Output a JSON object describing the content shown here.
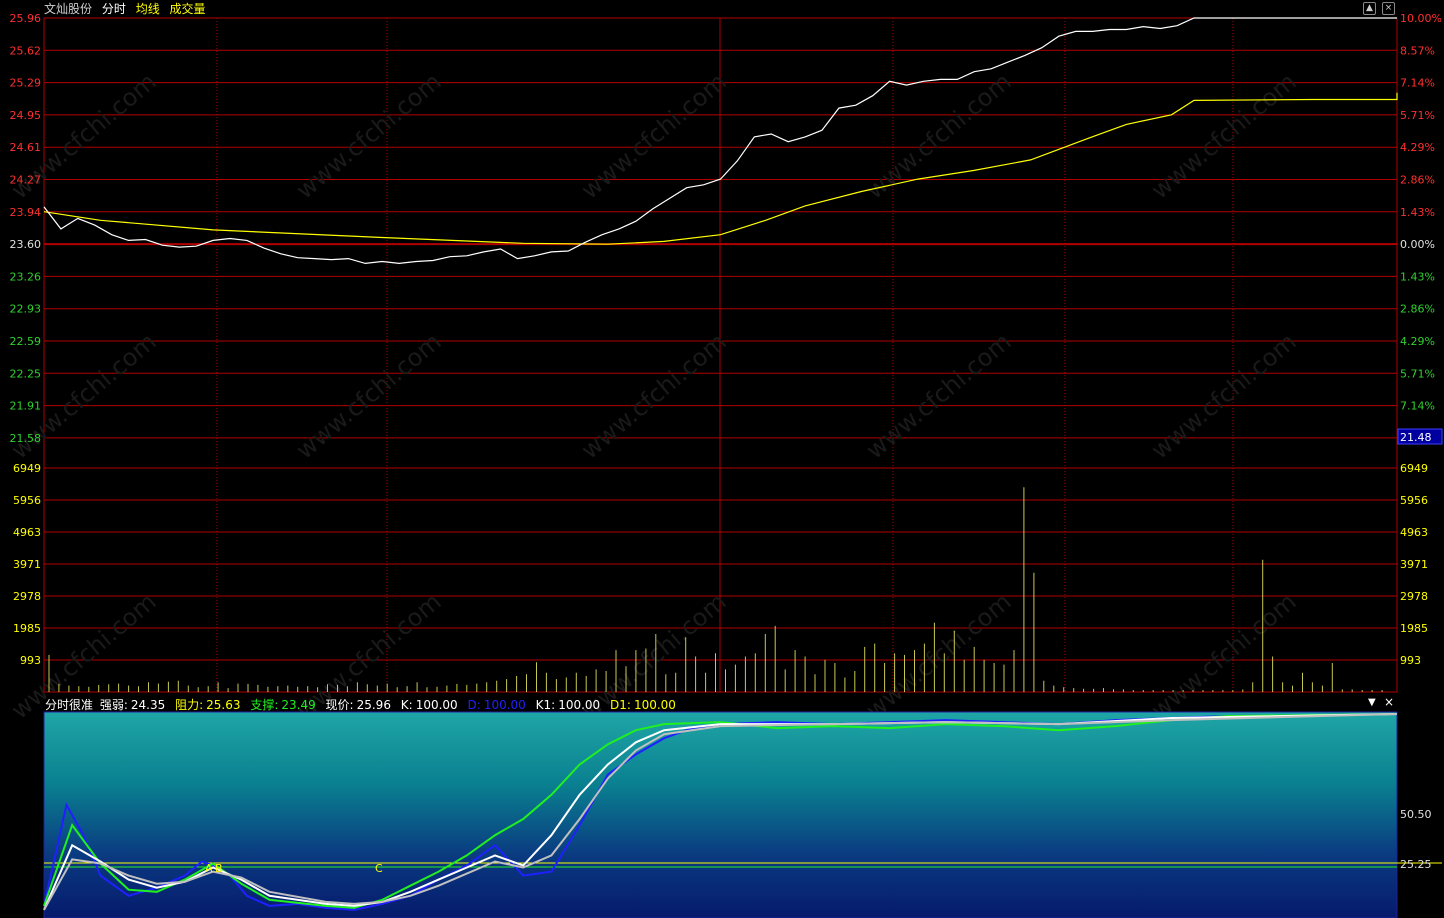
{
  "header": {
    "stock_name": "文灿股份",
    "tab_minute": "分时",
    "tab_avg": "均线",
    "tab_volume": "成交量"
  },
  "indicator_header": {
    "name": "分时很准",
    "strength_label": "强弱:",
    "strength_value": "24.35",
    "resistance_label": "阻力:",
    "resistance_value": "25.63",
    "support_label": "支撑:",
    "support_value": "23.49",
    "price_label": "现价:",
    "price_value": "25.96",
    "k_label": "K:",
    "k_value": "100.00",
    "d_label": "D:",
    "d_value": "100.00",
    "k1_label": "K1:",
    "k1_value": "100.00",
    "d1_label": "D1:",
    "d1_value": "100.00"
  },
  "colors": {
    "grid": "#b00000",
    "price_line": "#ffffff",
    "avg_line": "#ffff00",
    "volume_bar": "#c8c850",
    "up_axis": "#ff3030",
    "down_axis": "#30d030",
    "k_line": "#2020ff",
    "d_line": "#20f020",
    "k1_line": "#ffffff",
    "d1_line": "#c0c0c0"
  },
  "flag_labels": {
    "a": "A",
    "b": "B",
    "c": "C"
  },
  "chart_data": [
    {
      "type": "line",
      "title": "分时",
      "prev_close": 23.6,
      "ylim": [
        21.58,
        25.96
      ],
      "left_ticks": [
        "25.96",
        "25.62",
        "25.29",
        "24.95",
        "24.61",
        "24.27",
        "23.94",
        "23.60",
        "23.26",
        "22.93",
        "22.59",
        "22.25",
        "21.91",
        "21.58"
      ],
      "right_ticks": [
        "10.00%",
        "8.57%",
        "7.14%",
        "5.71%",
        "4.29%",
        "2.86%",
        "1.43%",
        "0.00%",
        "1.43%",
        "2.86%",
        "4.29%",
        "5.71%",
        "7.14%",
        "8.57%"
      ],
      "current_marker": "21.48",
      "x_minutes": 240,
      "series": [
        {
          "name": "分时",
          "key": "price",
          "points": [
            [
              0,
              23.99
            ],
            [
              3,
              23.76
            ],
            [
              6,
              23.87
            ],
            [
              9,
              23.8
            ],
            [
              12,
              23.7
            ],
            [
              15,
              23.64
            ],
            [
              18,
              23.65
            ],
            [
              21,
              23.59
            ],
            [
              24,
              23.57
            ],
            [
              27,
              23.58
            ],
            [
              30,
              23.64
            ],
            [
              33,
              23.66
            ],
            [
              36,
              23.64
            ],
            [
              39,
              23.56
            ],
            [
              42,
              23.5
            ],
            [
              45,
              23.46
            ],
            [
              48,
              23.45
            ],
            [
              51,
              23.44
            ],
            [
              54,
              23.45
            ],
            [
              57,
              23.4
            ],
            [
              60,
              23.42
            ],
            [
              63,
              23.4
            ],
            [
              66,
              23.42
            ],
            [
              69,
              23.43
            ],
            [
              72,
              23.47
            ],
            [
              75,
              23.48
            ],
            [
              78,
              23.52
            ],
            [
              81,
              23.55
            ],
            [
              84,
              23.45
            ],
            [
              87,
              23.48
            ],
            [
              90,
              23.52
            ],
            [
              93,
              23.53
            ],
            [
              96,
              23.62
            ],
            [
              99,
              23.7
            ],
            [
              102,
              23.76
            ],
            [
              105,
              23.84
            ],
            [
              108,
              23.97
            ],
            [
              111,
              24.08
            ],
            [
              114,
              24.19
            ],
            [
              117,
              24.22
            ],
            [
              120,
              24.28
            ],
            [
              123,
              24.47
            ],
            [
              126,
              24.72
            ],
            [
              129,
              24.75
            ],
            [
              132,
              24.67
            ],
            [
              135,
              24.72
            ],
            [
              138,
              24.79
            ],
            [
              141,
              25.02
            ],
            [
              144,
              25.05
            ],
            [
              147,
              25.15
            ],
            [
              150,
              25.3
            ],
            [
              153,
              25.26
            ],
            [
              156,
              25.3
            ],
            [
              159,
              25.32
            ],
            [
              162,
              25.32
            ],
            [
              165,
              25.4
            ],
            [
              168,
              25.43
            ],
            [
              171,
              25.5
            ],
            [
              174,
              25.57
            ],
            [
              177,
              25.65
            ],
            [
              180,
              25.77
            ],
            [
              183,
              25.82
            ],
            [
              186,
              25.82
            ],
            [
              189,
              25.84
            ],
            [
              192,
              25.84
            ],
            [
              195,
              25.87
            ],
            [
              198,
              25.85
            ],
            [
              201,
              25.88
            ],
            [
              204,
              25.96
            ],
            [
              240,
              25.96
            ]
          ]
        },
        {
          "name": "均线",
          "key": "avg",
          "points": [
            [
              0,
              23.94
            ],
            [
              10,
              23.85
            ],
            [
              30,
              23.75
            ],
            [
              60,
              23.67
            ],
            [
              85,
              23.61
            ],
            [
              100,
              23.6
            ],
            [
              110,
              23.63
            ],
            [
              120,
              23.7
            ],
            [
              128,
              23.85
            ],
            [
              135,
              24.0
            ],
            [
              145,
              24.15
            ],
            [
              155,
              24.28
            ],
            [
              165,
              24.37
            ],
            [
              175,
              24.48
            ],
            [
              185,
              24.7
            ],
            [
              192,
              24.85
            ],
            [
              200,
              24.95
            ],
            [
              204,
              25.1
            ],
            [
              225,
              25.11
            ],
            [
              255,
              25.11
            ],
            [
              265,
              25.15
            ],
            [
              300,
              25.17
            ],
            [
              330,
              25.18
            ]
          ]
        }
      ]
    },
    {
      "type": "bar",
      "title": "成交量",
      "ylim": [
        0,
        6949
      ],
      "left_ticks": [
        "6949",
        "5956",
        "4963",
        "3971",
        "2978",
        "1985",
        "993"
      ],
      "right_ticks": [
        "6949",
        "5956",
        "4963",
        "3971",
        "2978",
        "1985",
        "993"
      ],
      "x_minutes": 240,
      "values": [
        1150,
        250,
        200,
        180,
        160,
        220,
        240,
        260,
        200,
        180,
        300,
        260,
        320,
        350,
        200,
        150,
        180,
        300,
        120,
        260,
        250,
        220,
        160,
        180,
        200,
        160,
        180,
        150,
        240,
        220,
        180,
        300,
        240,
        200,
        260,
        150,
        180,
        300,
        150,
        160,
        200,
        250,
        220,
        260,
        300,
        350,
        400,
        500,
        550,
        920,
        600,
        400,
        450,
        600,
        500,
        700,
        650,
        1300,
        800,
        1300,
        1350,
        1800,
        550,
        600,
        1700,
        1100,
        600,
        1200,
        700,
        850,
        1100,
        1200,
        1800,
        2050,
        700,
        1300,
        1100,
        550,
        1000,
        900,
        450,
        650,
        1400,
        1500,
        900,
        1200,
        1150,
        1300,
        1500,
        2150,
        1200,
        1900,
        1000,
        1400,
        1000,
        900,
        850,
        1300,
        6350,
        3700,
        350,
        200,
        150,
        120,
        100,
        100,
        120,
        80,
        80,
        60,
        60,
        60,
        60,
        60,
        60,
        60,
        60,
        60,
        60,
        60,
        80,
        300,
        4100,
        1100,
        300,
        200,
        600,
        300,
        200,
        900,
        80,
        80,
        60,
        60,
        60
      ]
    },
    {
      "type": "line",
      "title": "分时很准",
      "ylim": [
        0,
        100
      ],
      "right_ticks": [
        "50.50",
        "25.25"
      ],
      "x_minutes": 240,
      "series": [
        {
          "name": "K",
          "key": "k",
          "points": [
            [
              0,
              5
            ],
            [
              4,
              55
            ],
            [
              7,
              40
            ],
            [
              10,
              20
            ],
            [
              15,
              10
            ],
            [
              20,
              14
            ],
            [
              25,
              20
            ],
            [
              28,
              27
            ],
            [
              30,
              25
            ],
            [
              33,
              20
            ],
            [
              36,
              10
            ],
            [
              40,
              5
            ],
            [
              45,
              6
            ],
            [
              50,
              4
            ],
            [
              55,
              3
            ],
            [
              60,
              6
            ],
            [
              65,
              10
            ],
            [
              70,
              18
            ],
            [
              75,
              25
            ],
            [
              80,
              35
            ],
            [
              85,
              20
            ],
            [
              90,
              22
            ],
            [
              95,
              45
            ],
            [
              100,
              70
            ],
            [
              105,
              80
            ],
            [
              110,
              88
            ],
            [
              115,
              93
            ],
            [
              120,
              95
            ],
            [
              130,
              96
            ],
            [
              140,
              95
            ],
            [
              150,
              96
            ],
            [
              160,
              97
            ],
            [
              170,
              96
            ],
            [
              180,
              95
            ],
            [
              190,
              97
            ],
            [
              200,
              98
            ],
            [
              210,
              99
            ],
            [
              240,
              100
            ]
          ]
        },
        {
          "name": "D",
          "key": "d",
          "points": [
            [
              0,
              5
            ],
            [
              5,
              45
            ],
            [
              10,
              26
            ],
            [
              15,
              13
            ],
            [
              20,
              12
            ],
            [
              25,
              18
            ],
            [
              30,
              26
            ],
            [
              35,
              16
            ],
            [
              40,
              8
            ],
            [
              50,
              5
            ],
            [
              55,
              4
            ],
            [
              60,
              8
            ],
            [
              65,
              15
            ],
            [
              70,
              22
            ],
            [
              75,
              30
            ],
            [
              80,
              40
            ],
            [
              85,
              48
            ],
            [
              90,
              60
            ],
            [
              95,
              75
            ],
            [
              100,
              85
            ],
            [
              105,
              92
            ],
            [
              110,
              95
            ],
            [
              120,
              96
            ],
            [
              130,
              93
            ],
            [
              140,
              94
            ],
            [
              150,
              93
            ],
            [
              160,
              95
            ],
            [
              170,
              94
            ],
            [
              180,
              92
            ],
            [
              190,
              94
            ],
            [
              200,
              97
            ],
            [
              210,
              99
            ],
            [
              240,
              100
            ]
          ]
        },
        {
          "name": "K1",
          "key": "k1",
          "points": [
            [
              0,
              3
            ],
            [
              5,
              35
            ],
            [
              10,
              27
            ],
            [
              15,
              18
            ],
            [
              20,
              14
            ],
            [
              25,
              17
            ],
            [
              30,
              24
            ],
            [
              35,
              18
            ],
            [
              40,
              10
            ],
            [
              50,
              6
            ],
            [
              55,
              5
            ],
            [
              60,
              7
            ],
            [
              65,
              12
            ],
            [
              70,
              18
            ],
            [
              75,
              24
            ],
            [
              80,
              30
            ],
            [
              85,
              25
            ],
            [
              90,
              40
            ],
            [
              95,
              60
            ],
            [
              100,
              75
            ],
            [
              105,
              86
            ],
            [
              110,
              92
            ],
            [
              120,
              95
            ],
            [
              140,
              95
            ],
            [
              160,
              96
            ],
            [
              180,
              95
            ],
            [
              200,
              98
            ],
            [
              240,
              100
            ]
          ]
        },
        {
          "name": "D1",
          "key": "d1",
          "points": [
            [
              0,
              3
            ],
            [
              5,
              28
            ],
            [
              10,
              26
            ],
            [
              15,
              20
            ],
            [
              20,
              16
            ],
            [
              25,
              17
            ],
            [
              30,
              22
            ],
            [
              35,
              19
            ],
            [
              40,
              12
            ],
            [
              50,
              7
            ],
            [
              55,
              6
            ],
            [
              60,
              7
            ],
            [
              65,
              10
            ],
            [
              70,
              15
            ],
            [
              75,
              21
            ],
            [
              80,
              27
            ],
            [
              85,
              24
            ],
            [
              90,
              30
            ],
            [
              95,
              48
            ],
            [
              100,
              68
            ],
            [
              105,
              82
            ],
            [
              110,
              90
            ],
            [
              120,
              94
            ],
            [
              140,
              95
            ],
            [
              160,
              96
            ],
            [
              180,
              95
            ],
            [
              200,
              97
            ],
            [
              240,
              100
            ]
          ]
        }
      ]
    }
  ]
}
